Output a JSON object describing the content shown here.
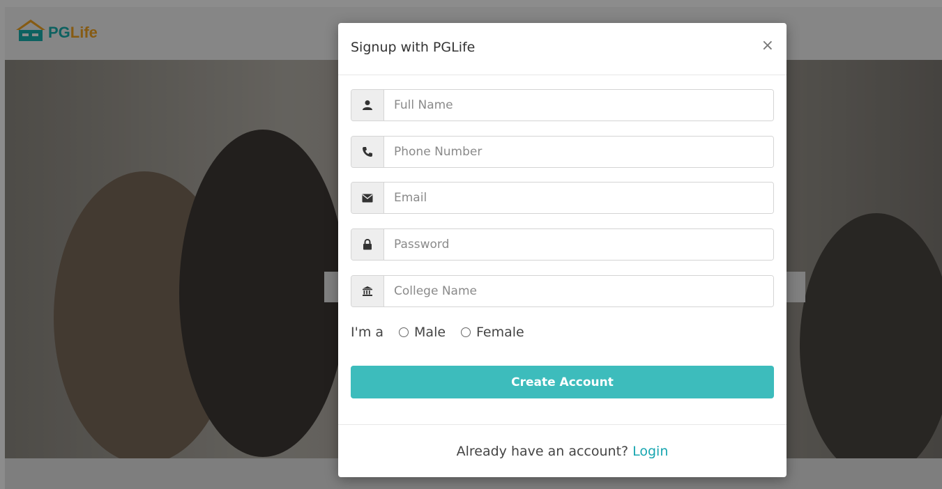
{
  "brand": {
    "pg": "PG",
    "life": "Life"
  },
  "modal": {
    "title": "Signup with PGLife",
    "close": "×",
    "fields": {
      "full_name": "Full Name",
      "phone": "Phone Number",
      "email": "Email",
      "password": "Password",
      "college": "College Name"
    },
    "gender": {
      "label": "I'm a",
      "male": "Male",
      "female": "Female"
    },
    "submit": "Create Account",
    "footer": {
      "text": "Already have an account?",
      "link": "Login"
    }
  },
  "colors": {
    "accent": "#3dbcbc",
    "link": "#18a6b0",
    "brand_teal": "#18b1b0",
    "brand_orange": "#f5a623"
  },
  "icons": [
    "user-icon",
    "phone-icon",
    "envelope-icon",
    "lock-icon",
    "university-icon",
    "house-logo-icon"
  ]
}
